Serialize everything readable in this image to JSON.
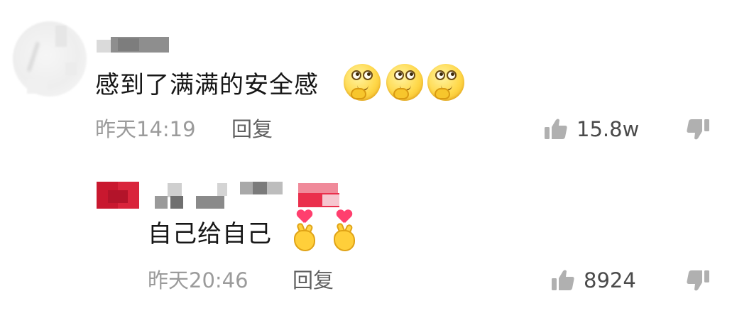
{
  "comments": [
    {
      "text": "感到了满满的安全感",
      "emoji_count": 3,
      "emoji": "thinking-face-emoji",
      "time": "昨天14:19",
      "reply_label": "回复",
      "likes": "15.8w"
    }
  ],
  "replies": [
    {
      "text": "自己给自己",
      "emoji_count": 2,
      "emoji": "finger-heart-emoji",
      "time": "昨天20:46",
      "reply_label": "回复",
      "likes": "8924"
    }
  ],
  "icons": {
    "like": "thumbs-up-icon",
    "dislike": "thumbs-down-icon"
  },
  "colors": {
    "text": "#161616",
    "meta": "#9b9b9b",
    "reply": "#5f5f5f",
    "icon": "#b0b0b0",
    "redacted_red": "#e83a52"
  }
}
